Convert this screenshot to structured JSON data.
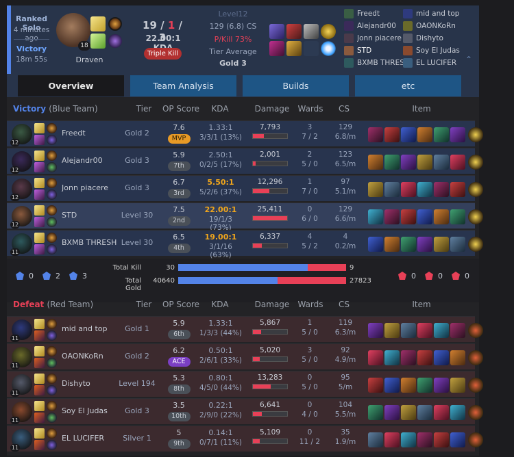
{
  "game": {
    "queue": "Ranked Solo",
    "time_ago": "4 minutes ago",
    "result": "Victory",
    "duration": "18m 55s",
    "champion": "Draven",
    "champion_level": "18",
    "kills": "19",
    "deaths": "1",
    "assists": "3",
    "kda_ratio": "22.00:1 KDA",
    "multikill": "Triple Kill",
    "level": "Level12",
    "cs": "129 (6.8) CS",
    "pkill": "P/Kill 73%",
    "tier_avg_label": "Tier Average",
    "tier_avg": "Gold 3"
  },
  "header_players": [
    {
      "name": "Freedt",
      "icon": "champ-icon",
      "color": "#3a5e44"
    },
    {
      "name": "Alejandr00",
      "icon": "champ-icon",
      "color": "#3b2a5a"
    },
    {
      "name": "Jonn piacere",
      "icon": "champ-icon",
      "color": "#4a3a4a"
    },
    {
      "name": "STD",
      "icon": "champ-icon",
      "color": "#8a5a3e"
    },
    {
      "name": "BXMB THRESH",
      "icon": "champ-icon",
      "color": "#2e5a5e"
    },
    {
      "name": "mid and top",
      "icon": "champ-icon",
      "color": "#2e3a7e"
    },
    {
      "name": "OAONKoRn",
      "icon": "champ-icon",
      "color": "#6a6a2a"
    },
    {
      "name": "Dishyto",
      "icon": "champ-icon",
      "color": "#555a6a"
    },
    {
      "name": "Soy El Judas",
      "icon": "champ-icon",
      "color": "#8a4a2e"
    },
    {
      "name": "EL LUCIFER",
      "icon": "champ-icon",
      "color": "#3a5e7e"
    }
  ],
  "tabs": [
    "Overview",
    "Team Analysis",
    "Builds",
    "etc"
  ],
  "columns": {
    "tier": "Tier",
    "op": "OP Score",
    "kda": "KDA",
    "damage": "Damage",
    "wards": "Wards",
    "cs": "CS",
    "item": "Item"
  },
  "blue_team": {
    "result": "Victory",
    "label": "(Blue Team)",
    "players": [
      {
        "name": "Freedt",
        "tier": "Gold 2",
        "op": "7.6",
        "rank": "MVP",
        "rank_type": "mvp",
        "kda": "1.33:1",
        "kda_gold": false,
        "kdastr": "3/3/1 (13%)",
        "damage": "7,793",
        "dmg_frac": 0.31,
        "wards": "3",
        "wards2": "7 / 2",
        "cs": "129",
        "csm": "6.8/m",
        "level": "12",
        "champ_color": "#3b5a44"
      },
      {
        "name": "Alejandr00",
        "tier": "Gold 3",
        "op": "5.9",
        "rank": "7th",
        "rank_type": "",
        "kda": "2.50:1",
        "kda_gold": false,
        "kdastr": "0/2/5 (17%)",
        "damage": "2,001",
        "dmg_frac": 0.08,
        "wards": "2",
        "wards2": "5 / 0",
        "cs": "123",
        "csm": "6.5/m",
        "level": "12",
        "champ_color": "#3b2a5a"
      },
      {
        "name": "Jonn piacere",
        "tier": "Gold 3",
        "op": "6.7",
        "rank": "3rd",
        "rank_type": "",
        "kda": "5.50:1",
        "kda_gold": true,
        "kdastr": "5/2/6 (37%)",
        "damage": "12,296",
        "dmg_frac": 0.48,
        "wards": "1",
        "wards2": "7 / 0",
        "cs": "97",
        "csm": "5.1/m",
        "level": "12",
        "champ_color": "#5a3a4a"
      },
      {
        "name": "STD",
        "tier": "Level 30",
        "op": "7.5",
        "rank": "2nd",
        "rank_type": "",
        "kda": "22.00:1",
        "kda_gold": true,
        "kdastr": "19/1/3 (73%)",
        "damage": "25,411",
        "dmg_frac": 1.0,
        "wards": "0",
        "wards2": "6 / 0",
        "cs": "129",
        "csm": "6.6/m",
        "level": "12",
        "champ_color": "#8a5a3e"
      },
      {
        "name": "BXMB THRESH",
        "tier": "Level 30",
        "op": "6.5",
        "rank": "4th",
        "rank_type": "",
        "kda": "19.00:1",
        "kda_gold": true,
        "kdastr": "3/1/16 (63%)",
        "damage": "6,337",
        "dmg_frac": 0.25,
        "wards": "4",
        "wards2": "5 / 2",
        "cs": "4",
        "csm": "0.2/m",
        "level": "11",
        "champ_color": "#2e5a5e"
      }
    ]
  },
  "summary": {
    "blue_obj": [
      {
        "icon": "baron-icon",
        "count": "0"
      },
      {
        "icon": "dragon-icon",
        "count": "2"
      },
      {
        "icon": "tower-icon",
        "count": "3"
      }
    ],
    "red_obj": [
      {
        "icon": "baron-icon",
        "count": "0"
      },
      {
        "icon": "dragon-icon",
        "count": "0"
      },
      {
        "icon": "tower-icon",
        "count": "0"
      }
    ],
    "total_kill_label": "Total Kill",
    "blue_kill": "30",
    "red_kill": "9",
    "kill_frac": 0.77,
    "total_gold_label": "Total Gold",
    "blue_gold": "40640",
    "red_gold": "27823",
    "gold_frac": 0.59,
    "blue_color": "#5383e8",
    "red_color": "#e84057"
  },
  "red_team": {
    "result": "Defeat",
    "label": "(Red Team)",
    "players": [
      {
        "name": "mid and top",
        "tier": "Gold 1",
        "op": "5.9",
        "rank": "6th",
        "rank_type": "",
        "kda": "1.33:1",
        "kda_gold": false,
        "kdastr": "1/3/3 (44%)",
        "damage": "5,867",
        "dmg_frac": 0.23,
        "wards": "1",
        "wards2": "5 / 0",
        "cs": "119",
        "csm": "6.3/m",
        "level": "11",
        "champ_color": "#2e3a7e"
      },
      {
        "name": "OAONKoRn",
        "tier": "Gold 2",
        "op": "6.2",
        "rank": "ACE",
        "rank_type": "ace",
        "kda": "0.50:1",
        "kda_gold": false,
        "kdastr": "2/6/1 (33%)",
        "damage": "5,020",
        "dmg_frac": 0.2,
        "wards": "3",
        "wards2": "5 / 0",
        "cs": "92",
        "csm": "4.9/m",
        "level": "11",
        "champ_color": "#6a6a2a"
      },
      {
        "name": "Dishyto",
        "tier": "Level 194",
        "op": "5.3",
        "rank": "8th",
        "rank_type": "",
        "kda": "0.80:1",
        "kda_gold": false,
        "kdastr": "4/5/0 (44%)",
        "damage": "13,283",
        "dmg_frac": 0.52,
        "wards": "0",
        "wards2": "5 / 0",
        "cs": "95",
        "csm": "5/m",
        "level": "11",
        "champ_color": "#555a6a"
      },
      {
        "name": "Soy El Judas",
        "tier": "Gold 3",
        "op": "3.5",
        "rank": "10th",
        "rank_type": "",
        "kda": "0.22:1",
        "kda_gold": false,
        "kdastr": "2/9/0 (22%)",
        "damage": "6,641",
        "dmg_frac": 0.26,
        "wards": "0",
        "wards2": "4 / 0",
        "cs": "104",
        "csm": "5.5/m",
        "level": "11",
        "champ_color": "#8a4a2e"
      },
      {
        "name": "EL LUCIFER",
        "tier": "Silver 1",
        "op": "5",
        "rank": "9th",
        "rank_type": "",
        "kda": "0.14:1",
        "kda_gold": false,
        "kdastr": "0/7/1 (11%)",
        "damage": "5,109",
        "dmg_frac": 0.2,
        "wards": "0",
        "wards2": "11 / 2",
        "cs": "35",
        "csm": "1.9/m",
        "level": "11",
        "champ_color": "#3a5e7e"
      }
    ]
  },
  "colors": {
    "victory": "#5383e8",
    "defeat": "#e84057",
    "mvp": "#e89a26",
    "ace": "#7b3fc4",
    "gold_kda": "#f0a61c"
  }
}
